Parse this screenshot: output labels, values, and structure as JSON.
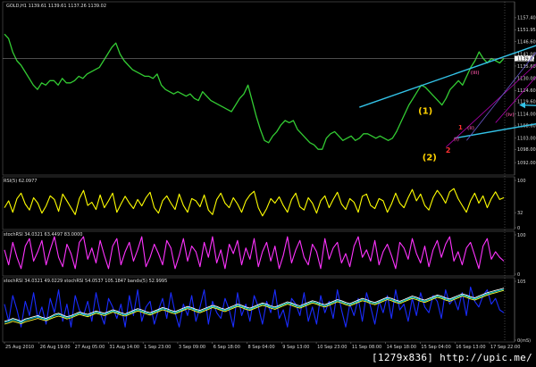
{
  "watermark": "[1279x836] http://upic.me/",
  "chart_data": [
    {
      "type": "line",
      "title": "GOLD,H1  1139.61 1139.61 1137.26 1139.02",
      "price_label": "1139.02",
      "ylim": [
        1088,
        1163
      ],
      "yticks": [
        "1157.40",
        "1151.95",
        "1146.60",
        "1141.00",
        "1135.60",
        "1130.00",
        "1124.60",
        "1119.60",
        "1114.00",
        "1108.60",
        "1103.00",
        "1098.00",
        "1092.00"
      ],
      "series": [
        {
          "color": "#33cc33",
          "values": [
            1150,
            1148,
            1142,
            1138,
            1136,
            1133,
            1130,
            1127,
            1125,
            1128,
            1127,
            1129,
            1129,
            1127,
            1130,
            1128,
            1128,
            1129,
            1131,
            1130,
            1132,
            1133,
            1134,
            1135,
            1138,
            1141,
            1144,
            1146,
            1141,
            1138,
            1136,
            1134,
            1133,
            1132,
            1131,
            1131,
            1130,
            1132,
            1127,
            1125,
            1124,
            1123,
            1124,
            1123,
            1122,
            1123,
            1121,
            1120,
            1124,
            1122,
            1120,
            1119,
            1118,
            1117,
            1116,
            1115,
            1118,
            1121,
            1123,
            1127,
            1120,
            1113,
            1107,
            1102,
            1101,
            1104,
            1106,
            1109,
            1111,
            1110,
            1111,
            1107,
            1105,
            1103,
            1101,
            1100,
            1098,
            1098,
            1103,
            1105,
            1106,
            1104,
            1102,
            1103,
            1104,
            1102,
            1103,
            1105,
            1105,
            1104,
            1103,
            1104,
            1103,
            1102,
            1103,
            1106,
            1110,
            1114,
            1118,
            1121,
            1124,
            1127,
            1126,
            1124,
            1122,
            1120,
            1118,
            1121,
            1125,
            1127,
            1129,
            1127,
            1131,
            1135,
            1138,
            1142,
            1139,
            1137,
            1139,
            1138,
            1137,
            1139
          ]
        }
      ],
      "labels": [
        {
          "text": "(1)",
          "x": 102,
          "y": 1114,
          "color": "#ffd200",
          "size": 10
        },
        {
          "text": "(2)",
          "x": 103,
          "y": 1093,
          "color": "#ffd200",
          "size": 10
        },
        {
          "text": "1",
          "x": 110.5,
          "y": 1107,
          "color": "#ff3030",
          "size": 7
        },
        {
          "text": "2",
          "x": 107.5,
          "y": 1096.5,
          "color": "#ff3030",
          "size": 8
        },
        {
          "text": "3",
          "x": 130,
          "y": 1149.5,
          "color": "#ff3030",
          "size": 8
        },
        {
          "text": "4",
          "x": 131,
          "y": 1135,
          "color": "#ff3030",
          "size": 7
        },
        {
          "text": "(i)",
          "x": 109.5,
          "y": 1102,
          "color": "#c04080",
          "size": 5
        },
        {
          "text": "(ii)",
          "x": 113,
          "y": 1107,
          "color": "#c04080",
          "size": 5
        },
        {
          "text": "(iii)",
          "x": 114,
          "y": 1132,
          "color": "#c04080",
          "size": 5
        },
        {
          "text": "(iv)",
          "x": 122.5,
          "y": 1113,
          "color": "#c04080",
          "size": 5
        },
        {
          "text": "(v)",
          "x": 130,
          "y": 1146,
          "color": "#c04080",
          "size": 5
        }
      ],
      "trendlines": [
        {
          "points": [
            [
              86,
              1117
            ],
            [
              149,
              1158
            ]
          ],
          "color": "#33c3e8",
          "width": 1.4,
          "arrow": true
        },
        {
          "points": [
            [
              109,
              1103
            ],
            [
              164,
              1121
            ]
          ],
          "color": "#33c3e8",
          "width": 1.4,
          "arrow": true
        },
        {
          "points": [
            [
              140,
              1117
            ],
            [
              125,
              1118
            ]
          ],
          "color": "#33c3e8",
          "width": 1.4,
          "arrow": true
        },
        {
          "points": [
            [
              107,
              1099
            ],
            [
              132,
              1142
            ]
          ],
          "color": "#b000b0",
          "width": 0.8,
          "arrow": false
        },
        {
          "points": [
            [
              119,
              1110
            ],
            [
              136,
              1146
            ]
          ],
          "color": "#b000b0",
          "width": 0.8,
          "arrow": false
        },
        {
          "points": [
            [
              112,
              1102
            ],
            [
              131,
              1147
            ]
          ],
          "color": "#6a5acd",
          "width": 0.8,
          "arrow": false
        }
      ]
    },
    {
      "type": "line",
      "title": "RSI(5) 62.0977",
      "ylim": [
        0,
        100
      ],
      "yticks": [
        "100",
        "32",
        "0"
      ],
      "series": [
        {
          "color": "#ffff00",
          "values": [
            40,
            55,
            30,
            60,
            72,
            48,
            35,
            62,
            50,
            28,
            44,
            66,
            58,
            32,
            70,
            55,
            40,
            25,
            60,
            78,
            45,
            52,
            36,
            68,
            40,
            55,
            72,
            30,
            48,
            65,
            50,
            38,
            58,
            44,
            62,
            74,
            40,
            28,
            55,
            66,
            50,
            36,
            70,
            45,
            30,
            60,
            55,
            42,
            68,
            35,
            25,
            58,
            72,
            50,
            40,
            62,
            48,
            30,
            55,
            68,
            76,
            40,
            22,
            38,
            60,
            50,
            64,
            45,
            30,
            58,
            72,
            42,
            35,
            62,
            50,
            28,
            55,
            66,
            40,
            58,
            74,
            48,
            36,
            60,
            52,
            30,
            65,
            70,
            45,
            38,
            60,
            55,
            30,
            48,
            72,
            50,
            40,
            62,
            80,
            55,
            70,
            45,
            35,
            62,
            78,
            66,
            50,
            75,
            82,
            60,
            45,
            30,
            55,
            72,
            50,
            66,
            40,
            60,
            75,
            58,
            62
          ]
        }
      ]
    },
    {
      "type": "line",
      "title": "stochRSI 34.0321 63.4497 83.0000",
      "ylim": [
        0,
        100
      ],
      "yticks": [
        "100",
        "0"
      ],
      "series": [
        {
          "color": "#ff33ff",
          "values": [
            60,
            20,
            80,
            40,
            10,
            70,
            90,
            30,
            55,
            85,
            20,
            60,
            95,
            40,
            15,
            75,
            50,
            10,
            80,
            95,
            35,
            65,
            25,
            85,
            45,
            10,
            70,
            90,
            20,
            55,
            80,
            30,
            60,
            95,
            15,
            40,
            75,
            50,
            20,
            85,
            65,
            10,
            45,
            90,
            30,
            70,
            55,
            15,
            80,
            40,
            95,
            25,
            60,
            10,
            75,
            50,
            85,
            20,
            65,
            35,
            90,
            15,
            55,
            80,
            30,
            70,
            10,
            45,
            95,
            25,
            60,
            85,
            40,
            20,
            75,
            55,
            10,
            90,
            35,
            65,
            80,
            25,
            50,
            15,
            70,
            95,
            40,
            60,
            30,
            85,
            20,
            55,
            75,
            45,
            10,
            80,
            65,
            35,
            90,
            50,
            25,
            70,
            15,
            60,
            85,
            40,
            75,
            95,
            30,
            55,
            20,
            65,
            80,
            45,
            10,
            70,
            90,
            35,
            55,
            40,
            30
          ]
        }
      ]
    },
    {
      "type": "line",
      "title": "stochRSI 34.0321 49.0229 stochRSI 54.0537 105.1847 bands(5) 52.9995",
      "ylim": [
        0,
        100
      ],
      "yticks": [
        "105",
        "0(mS)"
      ],
      "series": [
        {
          "color": "#1a2cff",
          "values": [
            60,
            30,
            75,
            50,
            20,
            65,
            40,
            80,
            35,
            55,
            25,
            70,
            45,
            85,
            30,
            60,
            20,
            75,
            50,
            40,
            65,
            30,
            80,
            45,
            25,
            70,
            55,
            35,
            60,
            20,
            75,
            40,
            85,
            30,
            55,
            65,
            25,
            50,
            70,
            35,
            80,
            45,
            20,
            60,
            40,
            75,
            30,
            55,
            85,
            25,
            65,
            45,
            35,
            70,
            50,
            20,
            80,
            40,
            60,
            30,
            75,
            55,
            25,
            65,
            45,
            85,
            35,
            50,
            20,
            70,
            60,
            40,
            80,
            30,
            55,
            25,
            75,
            45,
            65,
            35,
            85,
            50,
            20,
            60,
            40,
            70,
            30,
            80,
            55,
            25,
            65,
            45,
            75,
            35,
            85,
            50,
            60,
            30,
            70,
            40,
            80,
            55,
            45,
            75,
            65,
            35,
            85,
            60,
            70,
            50,
            80,
            40,
            90,
            65,
            55,
            75,
            85,
            60,
            70,
            50,
            45
          ]
        },
        {
          "color": "#ffffff",
          "values": [
            30,
            32,
            35,
            33,
            30,
            34,
            36,
            38,
            40,
            37,
            35,
            38,
            42,
            44,
            41,
            38,
            40,
            43,
            46,
            44,
            42,
            45,
            48,
            46,
            44,
            47,
            50,
            48,
            45,
            43,
            46,
            49,
            52,
            50,
            47,
            45,
            48,
            51,
            54,
            52,
            49,
            47,
            50,
            53,
            56,
            54,
            51,
            49,
            52,
            55,
            58,
            56,
            53,
            51,
            54,
            57,
            60,
            58,
            55,
            53,
            56,
            59,
            62,
            60,
            57,
            55,
            58,
            61,
            64,
            62,
            59,
            57,
            60,
            63,
            66,
            64,
            61,
            59,
            62,
            65,
            68,
            66,
            63,
            61,
            64,
            67,
            70,
            68,
            65,
            63,
            66,
            69,
            72,
            70,
            67,
            65,
            68,
            71,
            74,
            72,
            69,
            67,
            70,
            73,
            76,
            74,
            71,
            69,
            72,
            75,
            78,
            76,
            73,
            71,
            74,
            77,
            80,
            82,
            84,
            86,
            88
          ]
        },
        {
          "color": "#00e0e0",
          "values": [
            28,
            30,
            33,
            31,
            28,
            32,
            34,
            36,
            38,
            35,
            33,
            36,
            40,
            42,
            39,
            36,
            38,
            41,
            44,
            42,
            40,
            43,
            46,
            44,
            42,
            45,
            48,
            46,
            43,
            41,
            44,
            47,
            50,
            48,
            45,
            43,
            46,
            49,
            52,
            50,
            47,
            45,
            48,
            51,
            54,
            52,
            49,
            47,
            50,
            53,
            56,
            54,
            51,
            49,
            52,
            55,
            58,
            56,
            53,
            51,
            54,
            57,
            60,
            58,
            55,
            53,
            56,
            59,
            62,
            60,
            57,
            55,
            58,
            61,
            64,
            62,
            59,
            57,
            60,
            63,
            66,
            64,
            61,
            59,
            62,
            65,
            68,
            66,
            63,
            61,
            64,
            67,
            70,
            68,
            65,
            63,
            66,
            69,
            72,
            70,
            67,
            65,
            68,
            71,
            74,
            72,
            69,
            67,
            70,
            73,
            76,
            74,
            71,
            69,
            72,
            75,
            78,
            80,
            82,
            84,
            86
          ]
        },
        {
          "color": "#ffff33",
          "values": [
            25,
            27,
            30,
            28,
            26,
            29,
            31,
            33,
            35,
            33,
            31,
            34,
            37,
            39,
            37,
            34,
            36,
            39,
            42,
            40,
            38,
            41,
            44,
            42,
            40,
            43,
            46,
            44,
            41,
            39,
            42,
            45,
            48,
            46,
            43,
            41,
            44,
            47,
            50,
            48,
            45,
            43,
            46,
            49,
            52,
            50,
            47,
            45,
            48,
            51,
            54,
            52,
            49,
            47,
            50,
            53,
            56,
            54,
            51,
            49,
            52,
            55,
            58,
            56,
            53,
            51,
            54,
            57,
            60,
            58,
            55,
            53,
            56,
            59,
            62,
            60,
            57,
            55,
            58,
            61,
            64,
            62,
            59,
            57,
            60,
            63,
            66,
            64,
            61,
            59,
            62,
            65,
            68,
            66,
            63,
            61,
            64,
            67,
            70,
            68,
            65,
            63,
            66,
            69,
            72,
            70,
            67,
            65,
            68,
            71,
            74,
            72,
            69,
            67,
            70,
            73,
            76,
            78,
            80,
            82,
            84
          ]
        }
      ]
    }
  ],
  "x_axis": {
    "labels": [
      "25 Aug 2010",
      "26 Aug 19:00",
      "27 Aug 05:00",
      "31 Aug 14:00",
      "1 Sep 23:00",
      "3 Sep 09:00",
      "6 Sep 18:00",
      "8 Sep 04:00",
      "9 Sep 13:00",
      "10 Sep 23:00",
      "11 Sep 08:00",
      "14 Sep 18:00",
      "15 Sep 04:00",
      "16 Sep 13:00",
      "17 Sep 22:00"
    ]
  }
}
